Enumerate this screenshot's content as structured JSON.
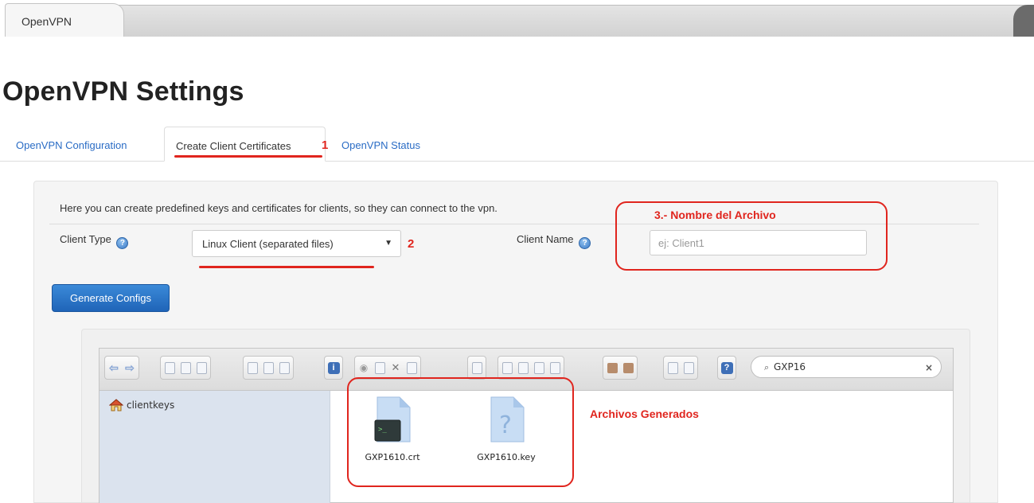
{
  "app_tab": {
    "label": "OpenVPN"
  },
  "page_title": "OpenVPN Settings",
  "subtabs": [
    {
      "label": "OpenVPN Configuration",
      "active": false
    },
    {
      "label": "Create Client Certificates",
      "active": true
    },
    {
      "label": "OpenVPN Status",
      "active": false
    }
  ],
  "form": {
    "intro": "Here you can create predefined keys and certificates for clients, so they can connect to the vpn.",
    "client_type_label": "Client Type",
    "client_type_value": "Linux Client (separated files)",
    "client_name_label": "Client Name",
    "client_name_placeholder": "ej: Client1",
    "client_name_value": "",
    "generate_label": "Generate Configs"
  },
  "file_manager": {
    "search_value": "GXP16",
    "tree": [
      {
        "label": "clientkeys"
      }
    ],
    "files": [
      {
        "name": "GXP1610.crt",
        "type": "certificate"
      },
      {
        "name": "GXP1610.key",
        "type": "unknown"
      }
    ]
  },
  "annotations": {
    "mark1": "1",
    "mark2": "2",
    "mark3": "3.- Nombre del Archivo",
    "generated": "Archivos Generados",
    "color": "#e0251e"
  },
  "icons": [
    "help-icon",
    "home-icon",
    "back-arrow-icon",
    "forward-arrow-icon",
    "info-icon",
    "eye-icon",
    "cut-icon",
    "help-square-icon",
    "search-icon",
    "clear-icon",
    "terminal-file-icon",
    "unknown-file-icon"
  ]
}
